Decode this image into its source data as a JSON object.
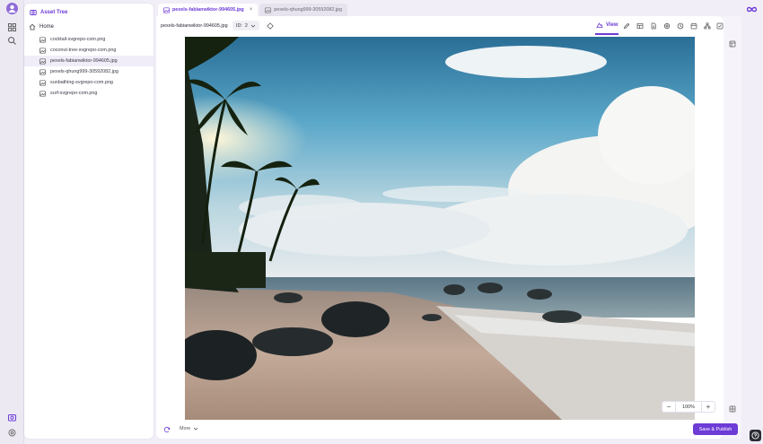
{
  "colors": {
    "accent": "#6d3bd6",
    "publish": "#6d3bd6"
  },
  "rail": {
    "icons": [
      "avatar",
      "dashboard-icon",
      "search-icon",
      "asset-tree-icon",
      "settings-icon"
    ]
  },
  "tree": {
    "title": "Asset Tree",
    "home": "Home",
    "files": [
      "cocktail-svgrepo-com.png",
      "coconut-tree-svgrepo-com.png",
      "pexels-fabianwiktor-994605.jpg",
      "pexels-qhung999-30592082.jpg",
      "sunbathing-svgrepo-com.png",
      "surf-svgrepo-com.png"
    ],
    "active_index": 2
  },
  "tabs": [
    {
      "label": "pexels-fabianwiktor-994605.jpg",
      "active": true
    },
    {
      "label": "pexels-qhung999-30592082.jpg",
      "active": false
    }
  ],
  "toolbar": {
    "filename": "pexels-fabianwiktor-994605.jpg",
    "id_label": "ID:",
    "id_value": "2",
    "view_label": "View"
  },
  "zoom": {
    "minus": "−",
    "value": "100%",
    "plus": "+"
  },
  "bottom": {
    "more_label": "More"
  },
  "publish_label": "Save & Publish"
}
